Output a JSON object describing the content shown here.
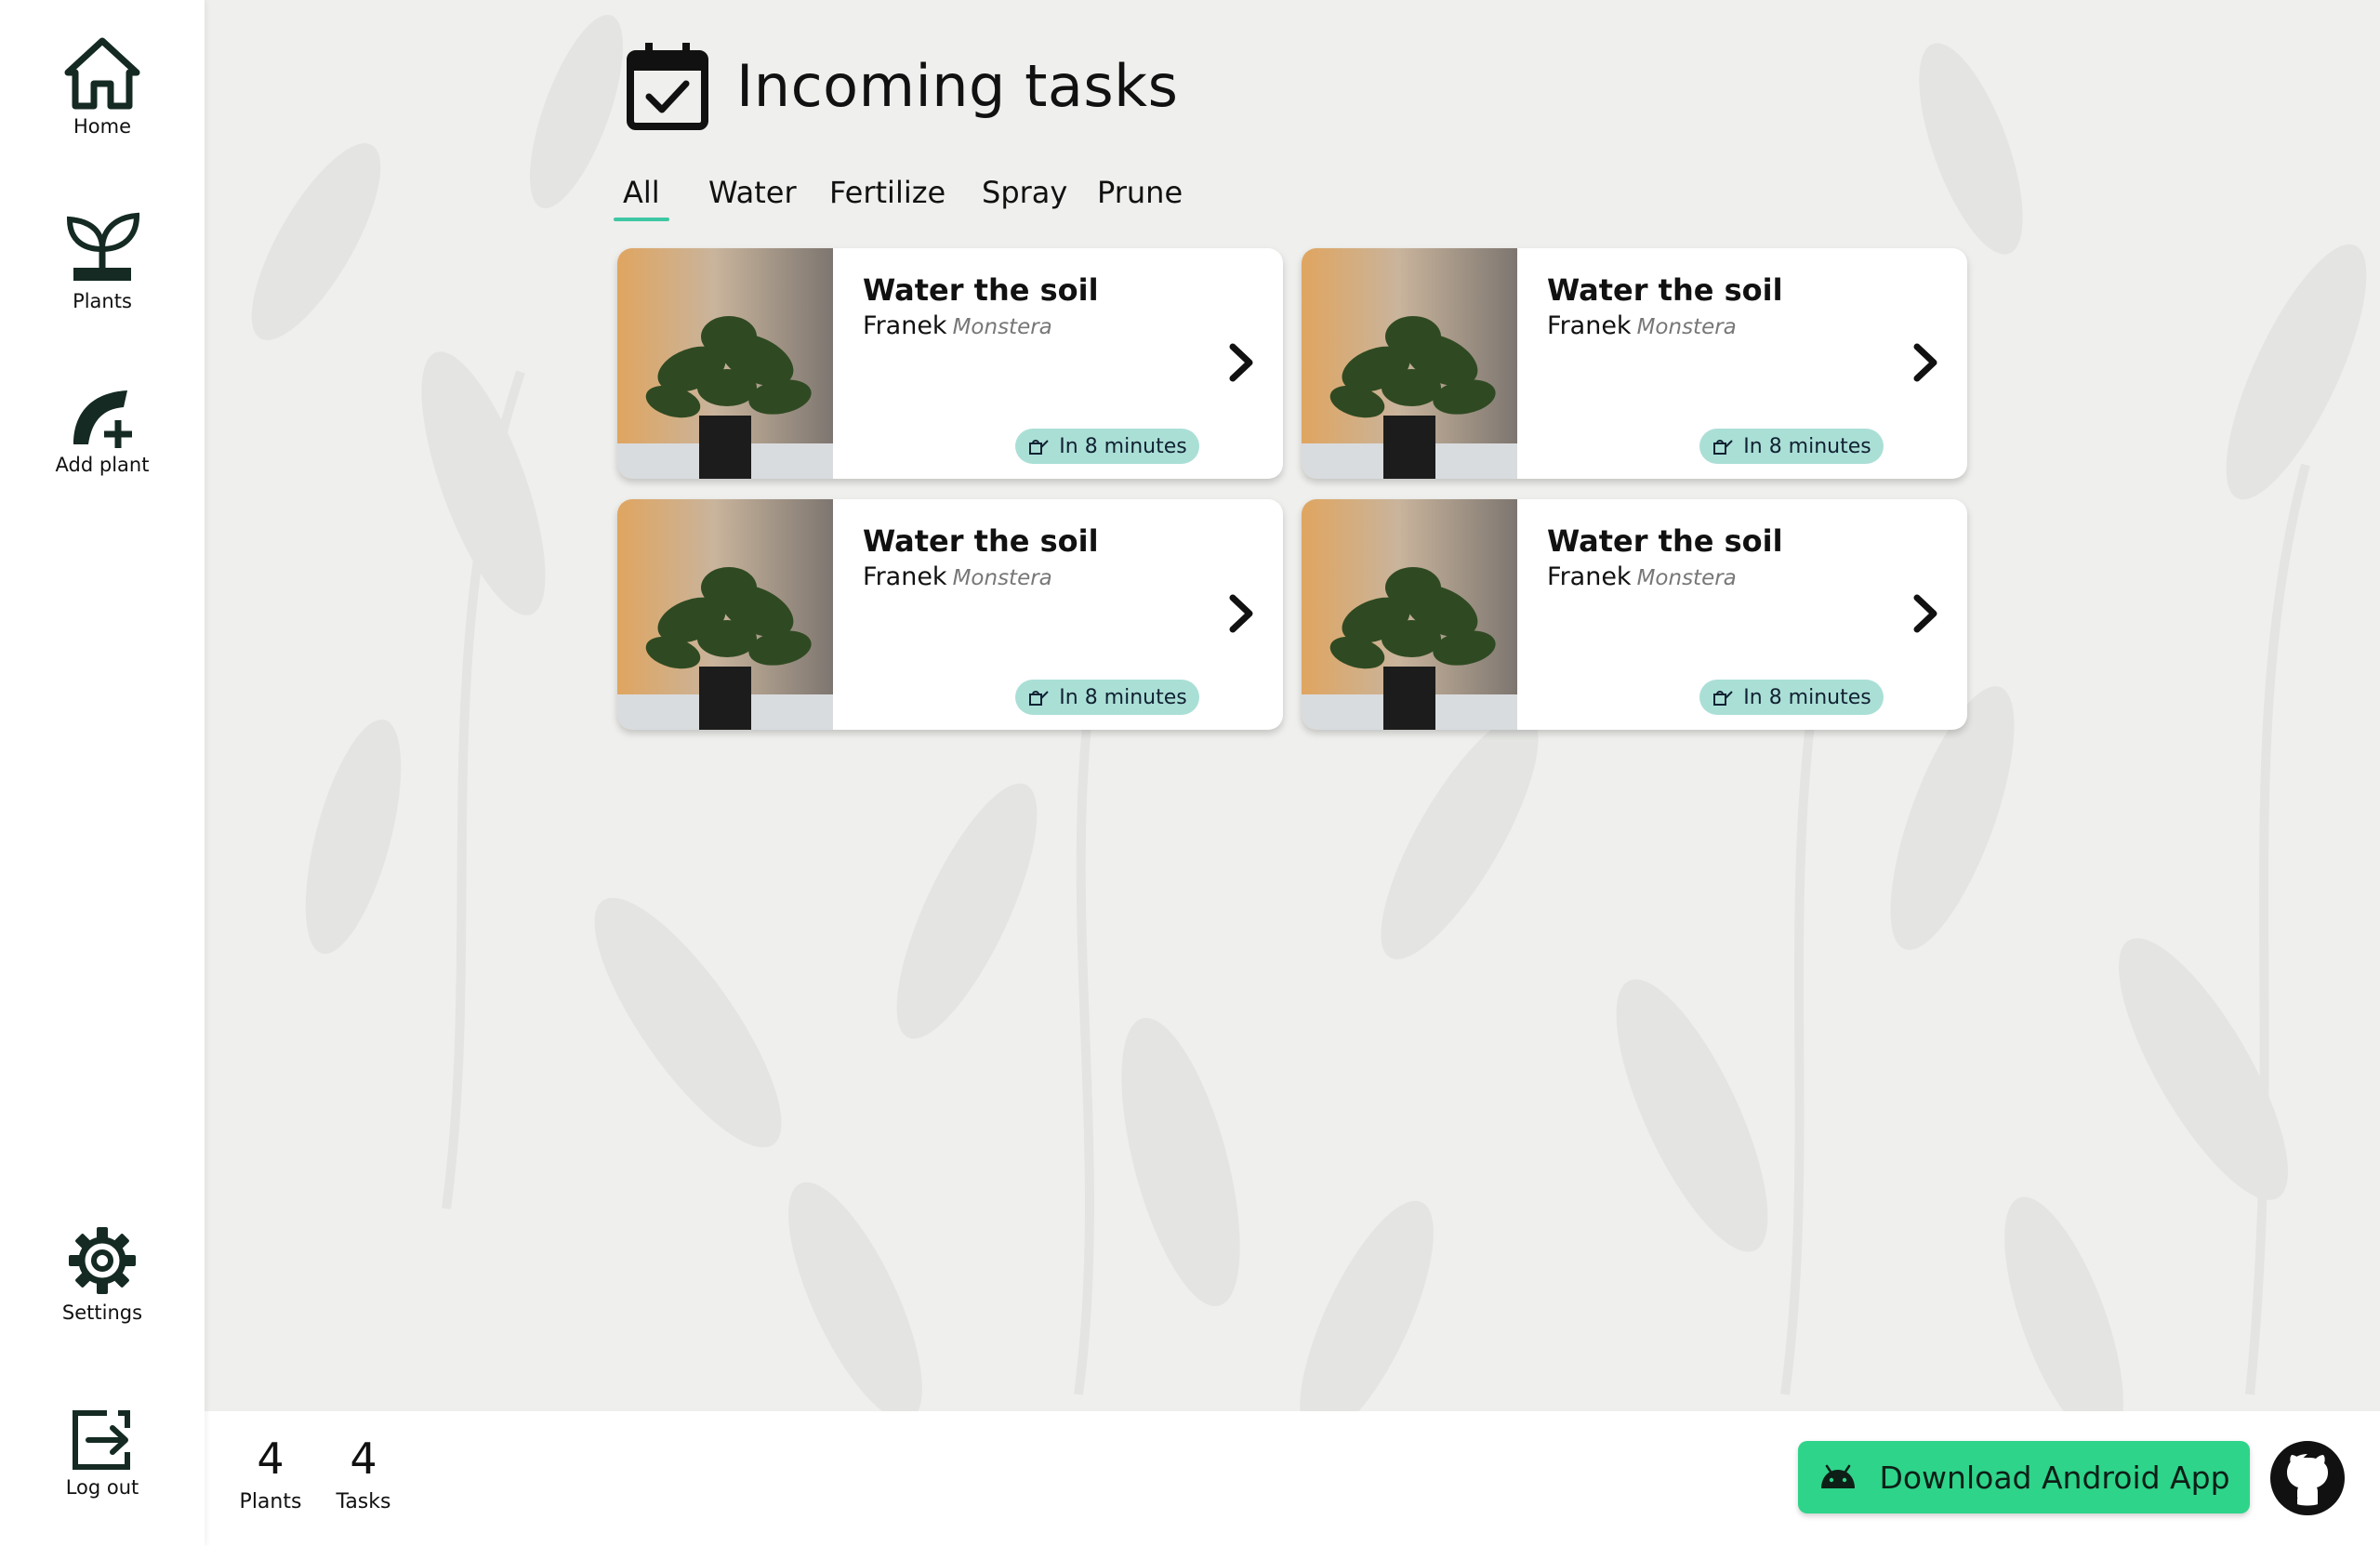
{
  "sidebar": {
    "items": [
      {
        "label": "Home",
        "icon": "home-icon"
      },
      {
        "label": "Plants",
        "icon": "sprout-icon"
      },
      {
        "label": "Add plant",
        "icon": "add-plant-icon"
      },
      {
        "label": "Settings",
        "icon": "gear-icon"
      },
      {
        "label": "Log out",
        "icon": "logout-icon"
      }
    ]
  },
  "header": {
    "title": "Incoming tasks",
    "icon": "calendar-check-icon"
  },
  "tabs": [
    {
      "label": "All",
      "active": true
    },
    {
      "label": "Water",
      "active": false
    },
    {
      "label": "Fertilize",
      "active": false
    },
    {
      "label": "Spray",
      "active": false
    },
    {
      "label": "Prune",
      "active": false
    }
  ],
  "tasks": [
    {
      "title": "Water the soil",
      "plant": "Franek",
      "species": "Monstera",
      "due": "In 8 minutes",
      "badge_icon": "watering-can-icon"
    },
    {
      "title": "Water the soil",
      "plant": "Franek",
      "species": "Monstera",
      "due": "In 8 minutes",
      "badge_icon": "watering-can-icon"
    },
    {
      "title": "Water the soil",
      "plant": "Franek",
      "species": "Monstera",
      "due": "In 8 minutes",
      "badge_icon": "watering-can-icon"
    },
    {
      "title": "Water the soil",
      "plant": "Franek",
      "species": "Monstera",
      "due": "In 8 minutes",
      "badge_icon": "watering-can-icon"
    }
  ],
  "footer": {
    "stats": [
      {
        "value": "4",
        "label": "Plants"
      },
      {
        "value": "4",
        "label": "Tasks"
      }
    ],
    "download_label": "Download Android App",
    "download_icon": "android-icon",
    "github_icon": "github-icon"
  },
  "colors": {
    "accent": "#3ec7a3",
    "badge": "#aadfd6",
    "download_button": "#2ed48a",
    "background": "#efefed"
  }
}
